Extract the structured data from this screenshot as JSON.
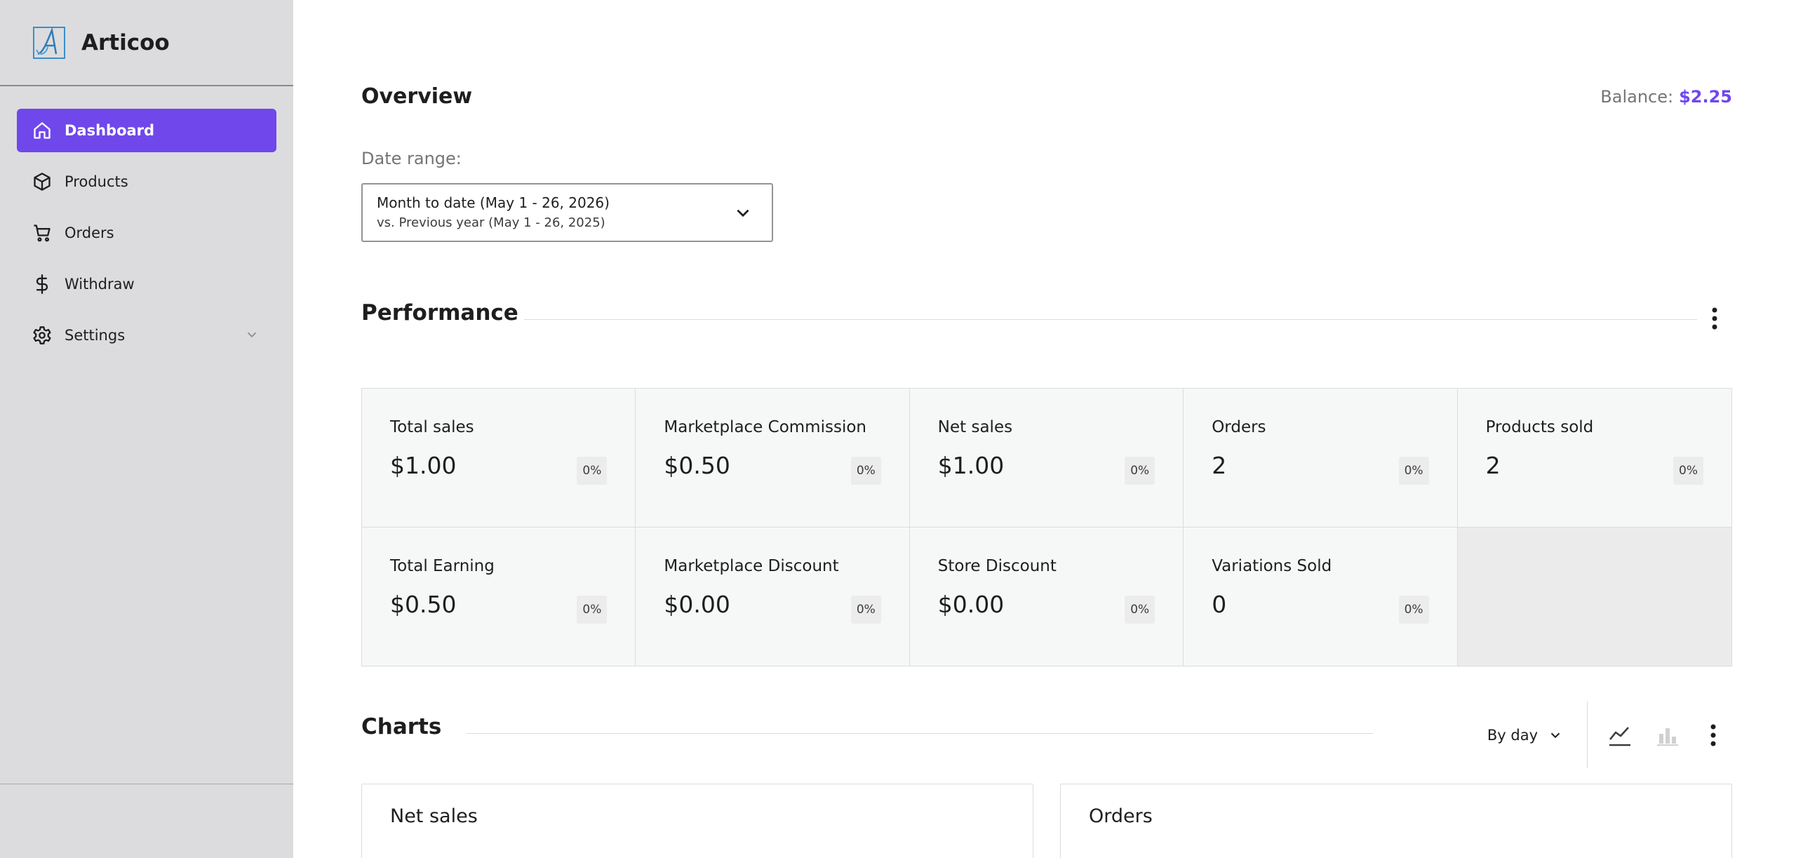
{
  "sidebar": {
    "brand": "Articoo",
    "items": [
      {
        "label": "Dashboard",
        "icon": "home-icon"
      },
      {
        "label": "Products",
        "icon": "box-icon"
      },
      {
        "label": "Orders",
        "icon": "cart-icon"
      },
      {
        "label": "Withdraw",
        "icon": "dollar-icon"
      },
      {
        "label": "Settings",
        "icon": "gear-icon"
      }
    ]
  },
  "header": {
    "title": "Overview",
    "balance_label": "Balance:",
    "balance_value": "$2.25"
  },
  "date_range": {
    "label": "Date range:",
    "primary": "Month to date (May 1 - 26, 2026)",
    "secondary": "vs. Previous year (May 1 - 26, 2025)"
  },
  "performance": {
    "title": "Performance",
    "stats": [
      {
        "label": "Total sales",
        "value": "$1.00",
        "delta": "0%"
      },
      {
        "label": "Marketplace Commission",
        "value": "$0.50",
        "delta": "0%"
      },
      {
        "label": "Net sales",
        "value": "$1.00",
        "delta": "0%"
      },
      {
        "label": "Orders",
        "value": "2",
        "delta": "0%"
      },
      {
        "label": "Products sold",
        "value": "2",
        "delta": "0%"
      },
      {
        "label": "Total Earning",
        "value": "$0.50",
        "delta": "0%"
      },
      {
        "label": "Marketplace Discount",
        "value": "$0.00",
        "delta": "0%"
      },
      {
        "label": "Store Discount",
        "value": "$0.00",
        "delta": "0%"
      },
      {
        "label": "Variations Sold",
        "value": "0",
        "delta": "0%"
      }
    ]
  },
  "charts": {
    "title": "Charts",
    "interval": "By day",
    "cards": [
      "Net sales",
      "Orders"
    ]
  },
  "colors": {
    "accent": "#7047eb",
    "sidebar_bg": "#dcdcde",
    "tile_bg": "#f6f7f7"
  }
}
